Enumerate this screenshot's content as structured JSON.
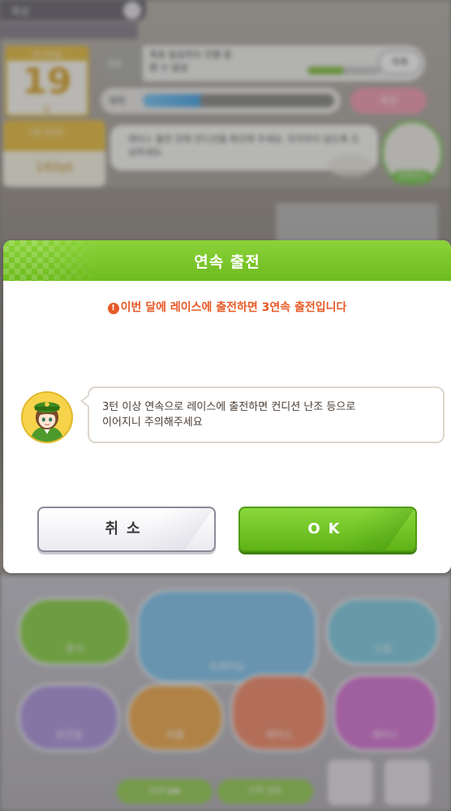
{
  "background": {
    "top_label": "육성",
    "calendar": {
      "header": "주니어급",
      "day": "19",
      "sub": "턴"
    },
    "goal": {
      "tag": "목표",
      "text_line1": "목표 달성까지 진행 중",
      "text_line2": "팬 수 달성",
      "button": "목록"
    },
    "energy": {
      "label": "체력",
      "level": 0.3
    },
    "pink_button": "육성",
    "points": {
      "header": "스킬 포인트",
      "value": "160pt"
    },
    "speech": "레이스 출전 전에 컨디션을 확인해 주세요. 무리하지 않도록 조심하세요.",
    "avatar_tag": "트레이너",
    "menu": [
      "휴식",
      "트레이닝",
      "스킬",
      "보건실",
      "외출",
      "레이스",
      "레이스"
    ],
    "skip": "SKIP ▶▶",
    "quick": "단축 설정"
  },
  "dialog": {
    "title": "연속 출전",
    "warning_icon": "!",
    "warning": "이번 달에 레이스에 출전하면 3연속 출전입니다",
    "message_line1": "3턴 이상 연속으로 레이스에 출전하면 컨디션 난조 등으로",
    "message_line2": "이어지니 주의해주세요",
    "cancel_label": "취소",
    "ok_label": "OK"
  },
  "colors": {
    "header_green": "#7ac62b",
    "warning_orange": "#e85a27",
    "ok_green": "#6dbb1e"
  },
  "icons": {
    "warning": "exclamation-circle-icon",
    "avatar": "character-portrait-icon"
  }
}
